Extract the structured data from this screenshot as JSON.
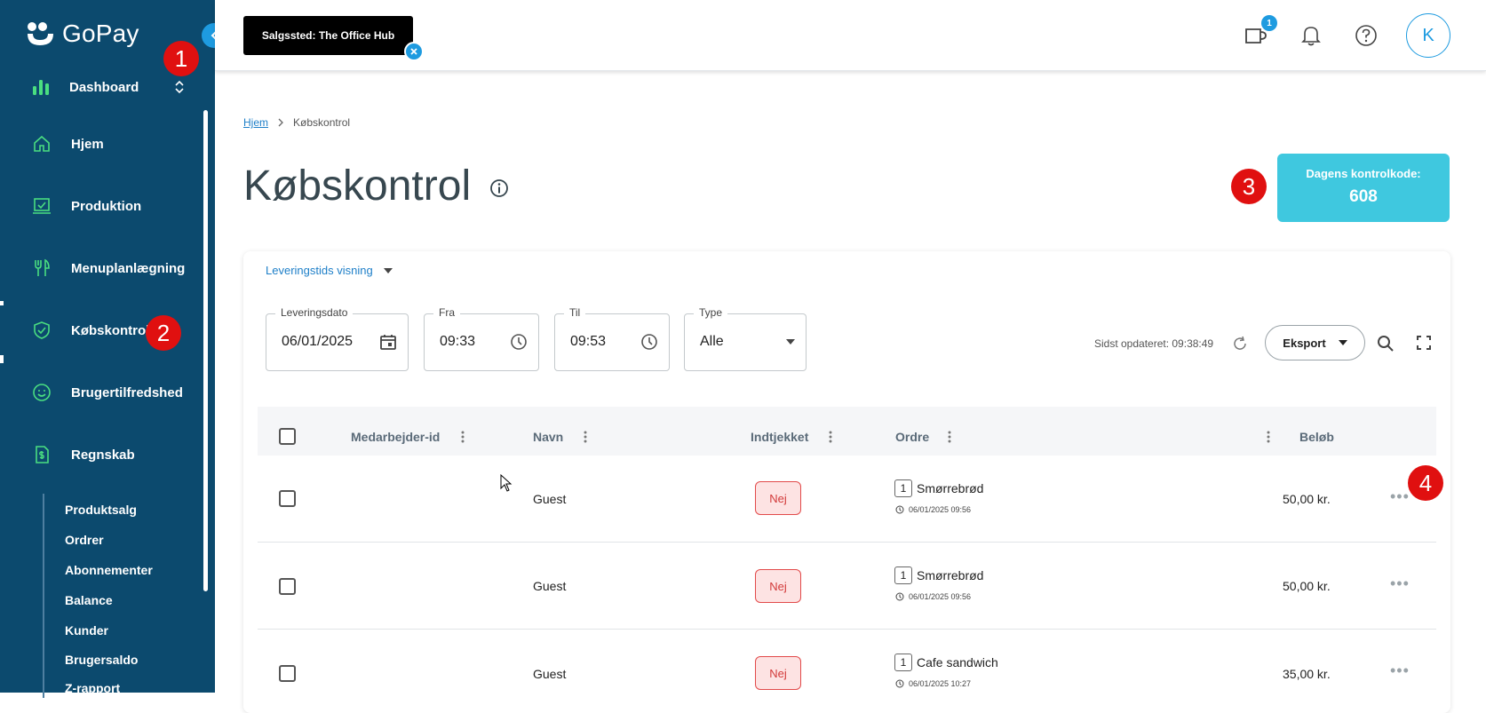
{
  "app": {
    "name": "GoPay"
  },
  "sidebar": {
    "dashboard_label": "Dashboard",
    "items": [
      {
        "label": "Hjem",
        "icon": "home-icon"
      },
      {
        "label": "Produktion",
        "icon": "production-icon"
      },
      {
        "label": "Menuplanlægning",
        "icon": "fork-knife-icon"
      },
      {
        "label": "Købskontrol",
        "icon": "shield-check-icon"
      },
      {
        "label": "Brugertilfredshed",
        "icon": "smiley-icon"
      },
      {
        "label": "Regnskab",
        "icon": "receipt-dollar-icon"
      }
    ],
    "subitems": [
      "Produktsalg",
      "Ordrer",
      "Abonnementer",
      "Balance",
      "Kunder",
      "Brugersaldo",
      "Z-rapport"
    ]
  },
  "topbar": {
    "store_label": "Salgssted: The Office Hub",
    "notification_badge": "1",
    "avatar_initial": "K"
  },
  "breadcrumb": {
    "home": "Hjem",
    "current": "Købskontrol"
  },
  "page": {
    "title": "Købskontrol"
  },
  "control_code": {
    "label": "Dagens kontrolkode:",
    "value": "608"
  },
  "filters": {
    "view_select": "Leveringstids visning",
    "date": {
      "label": "Leveringsdato",
      "value": "06/01/2025"
    },
    "from": {
      "label": "Fra",
      "value": "09:33"
    },
    "to": {
      "label": "Til",
      "value": "09:53"
    },
    "type": {
      "label": "Type",
      "value": "Alle"
    },
    "last_updated": "Sidst opdateret: 09:38:49",
    "export_label": "Eksport"
  },
  "table": {
    "headers": {
      "employee_id": "Medarbejder-id",
      "name": "Navn",
      "checked_in": "Indtjekket",
      "order": "Ordre",
      "amount": "Beløb"
    },
    "rows": [
      {
        "employee_id": "",
        "name": "Guest",
        "checked_in": "Nej",
        "qty": "1",
        "order": "Smørrebrød",
        "time": "06/01/2025 09:56",
        "amount": "50,00 kr."
      },
      {
        "employee_id": "",
        "name": "Guest",
        "checked_in": "Nej",
        "qty": "1",
        "order": "Smørrebrød",
        "time": "06/01/2025 09:56",
        "amount": "50,00 kr."
      },
      {
        "employee_id": "",
        "name": "Guest",
        "checked_in": "Nej",
        "qty": "1",
        "order": "Cafe sandwich",
        "time": "06/01/2025 10:27",
        "amount": "35,00 kr."
      }
    ]
  },
  "markers": [
    "1",
    "2",
    "3",
    "4"
  ],
  "colors": {
    "sidebar": "#0c4a6e",
    "accent": "#1e9be0",
    "code_box": "#3fc8df",
    "marker": "#e01010",
    "nej_border": "#e24a4a"
  }
}
